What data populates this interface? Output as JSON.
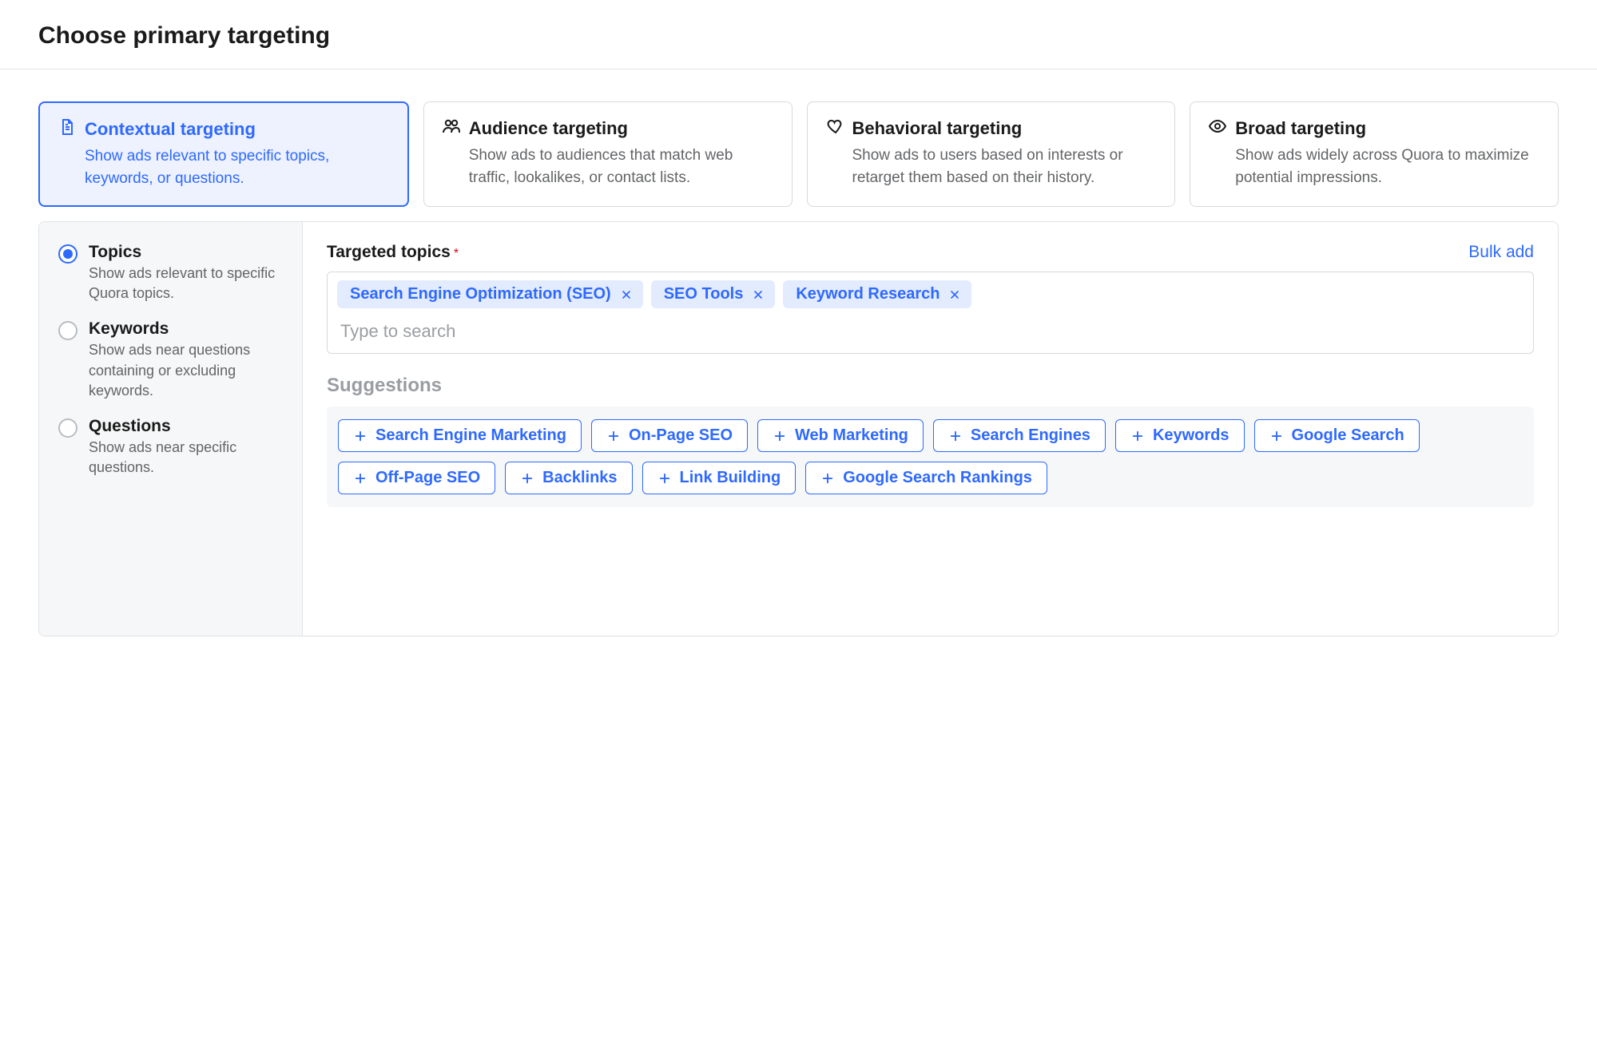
{
  "page_title": "Choose primary targeting",
  "targeting_options": [
    {
      "icon": "document-icon",
      "title": "Contextual targeting",
      "desc": "Show ads relevant to specific topics, keywords, or questions.",
      "selected": true
    },
    {
      "icon": "people-icon",
      "title": "Audience targeting",
      "desc": "Show ads to audiences that match web traffic, lookalikes, or contact lists.",
      "selected": false
    },
    {
      "icon": "heart-icon",
      "title": "Behavioral targeting",
      "desc": "Show ads to users based on interests or retarget them based on their history.",
      "selected": false
    },
    {
      "icon": "eye-icon",
      "title": "Broad targeting",
      "desc": "Show ads widely across Quora to maximize potential impressions.",
      "selected": false
    }
  ],
  "sidebar_options": [
    {
      "label": "Topics",
      "desc": "Show ads relevant to specific Quora topics.",
      "checked": true
    },
    {
      "label": "Keywords",
      "desc": "Show ads near questions containing or excluding keywords.",
      "checked": false
    },
    {
      "label": "Questions",
      "desc": "Show ads near specific questions.",
      "checked": false
    }
  ],
  "main": {
    "section_title": "Targeted topics",
    "bulk_add_label": "Bulk add",
    "search_placeholder": "Type to search",
    "selected_topics": [
      "Search Engine Optimization (SEO)",
      "SEO Tools",
      "Keyword Research"
    ],
    "suggestions_title": "Suggestions",
    "suggestions": [
      "Search Engine Marketing",
      "On-Page SEO",
      "Web Marketing",
      "Search Engines",
      "Keywords",
      "Google Search",
      "Off-Page SEO",
      "Backlinks",
      "Link Building",
      "Google Search Rankings"
    ]
  }
}
